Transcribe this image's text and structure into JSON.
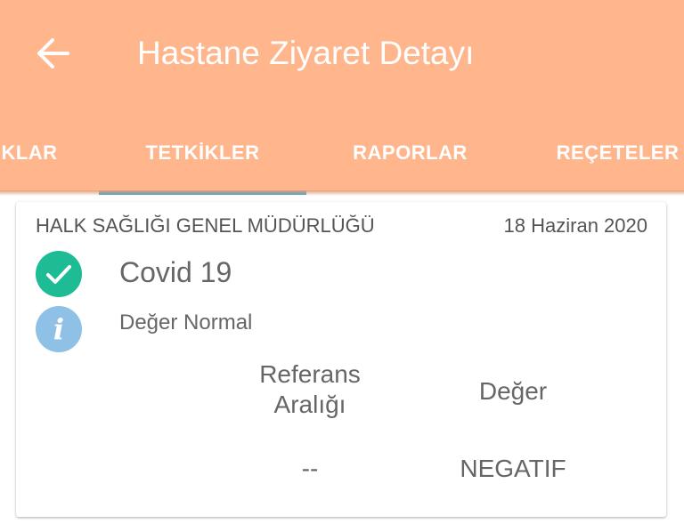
{
  "appbar": {
    "title": "Hastane Ziyaret Detayı",
    "background_color": "#ffb68d",
    "back_icon": "arrow-left-icon"
  },
  "tabs": [
    {
      "label": "KLAR",
      "selected": false
    },
    {
      "label": "TETKİKLER",
      "selected": true
    },
    {
      "label": "RAPORLAR",
      "selected": false
    },
    {
      "label": "REÇETELER",
      "selected": false
    }
  ],
  "tab_indicator_color": "#3aa3d6",
  "result_card": {
    "organization": "HALK SAĞLIĞI GENEL MÜDÜRLÜĞÜ",
    "date": "18 Haziran 2020",
    "status_icon": "check-circle-icon",
    "status_color": "#1dbc95",
    "test_name": "Covid 19",
    "info_icon": "info-icon",
    "info_color": "#8fc0e6",
    "info_glyph": "i",
    "value_status": "Değer Normal",
    "columns": {
      "reference_line1": "Referans",
      "reference_line2": "Aralığı",
      "value": "Değer"
    },
    "row": {
      "reference": "--",
      "value": "NEGATIF"
    }
  }
}
